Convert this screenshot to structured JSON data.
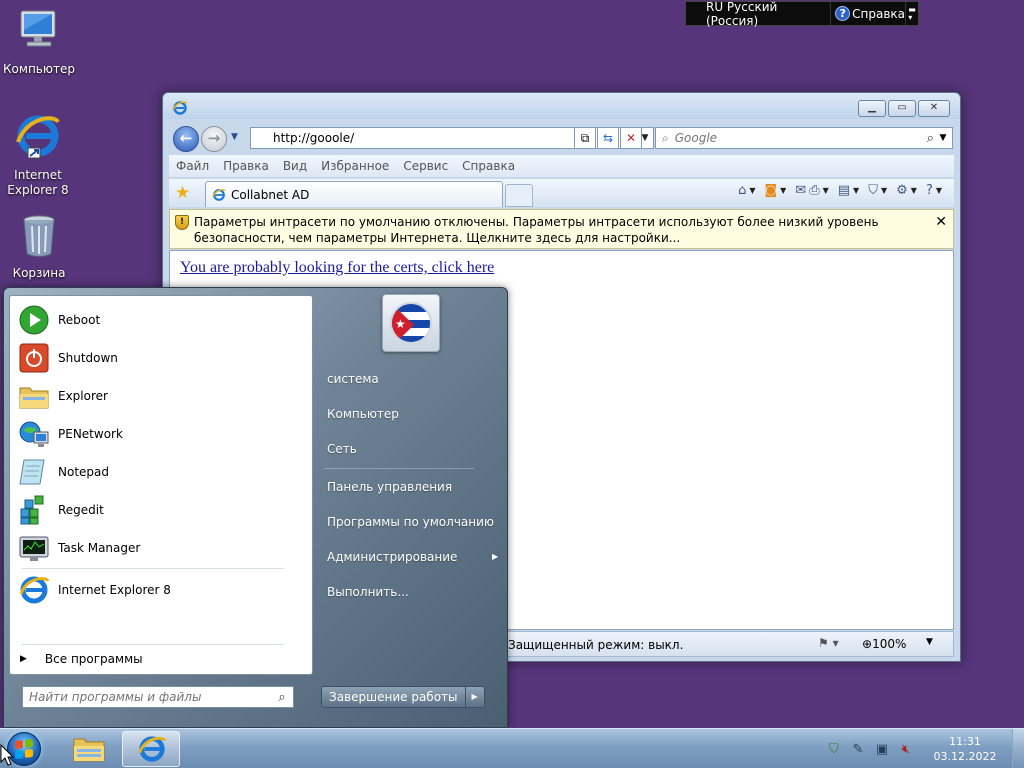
{
  "langbar": {
    "language": "RU Русский (Россия)",
    "help_label": "Справка"
  },
  "desktop": {
    "icons": [
      {
        "label": "Компьютер",
        "icon": "computer-icon"
      },
      {
        "label": "Internet Explorer 8",
        "icon": "ie-icon"
      },
      {
        "label": "Корзина",
        "icon": "recycle-bin-icon"
      }
    ]
  },
  "browser": {
    "address": "http://gooole/",
    "search_placeholder": "Google",
    "menu": [
      "Файл",
      "Правка",
      "Вид",
      "Избранное",
      "Сервис",
      "Справка"
    ],
    "tab_title": "Collabnet AD",
    "infobar_text": "Параметры интрасети по умолчанию отключены. Параметры интрасети используют более низкий уровень безопасности, чем параметры Интернета. Щелкните здесь для настройки...",
    "link_text": "You are probably looking for the certs, click here",
    "protected_mode": "Защищенный режим: выкл.",
    "zoom": "100%"
  },
  "start_menu": {
    "programs": [
      {
        "label": "Reboot",
        "icon": "reboot-icon"
      },
      {
        "label": "Shutdown",
        "icon": "shutdown-icon"
      },
      {
        "label": "Explorer",
        "icon": "explorer-folder-icon"
      },
      {
        "label": "PENetwork",
        "icon": "network-icon"
      },
      {
        "label": "Notepad",
        "icon": "notepad-icon"
      },
      {
        "label": "Regedit",
        "icon": "regedit-icon"
      },
      {
        "label": "Task Manager",
        "icon": "task-manager-icon"
      },
      {
        "label": "Internet Explorer 8",
        "icon": "ie-icon"
      }
    ],
    "all_programs": "Все программы",
    "search_placeholder": "Найти программы и файлы",
    "right_items": [
      "система",
      "Компьютер",
      "Сеть",
      "Панель управления",
      "Программы по умолчанию",
      "Администрирование",
      "Выполнить..."
    ],
    "shutdown_label": "Завершение работы"
  },
  "taskbar": {
    "time": "11:31",
    "date": "03.12.2022"
  },
  "colors": {
    "desktop_bg": "#56357a",
    "accent": "#2557b8"
  }
}
